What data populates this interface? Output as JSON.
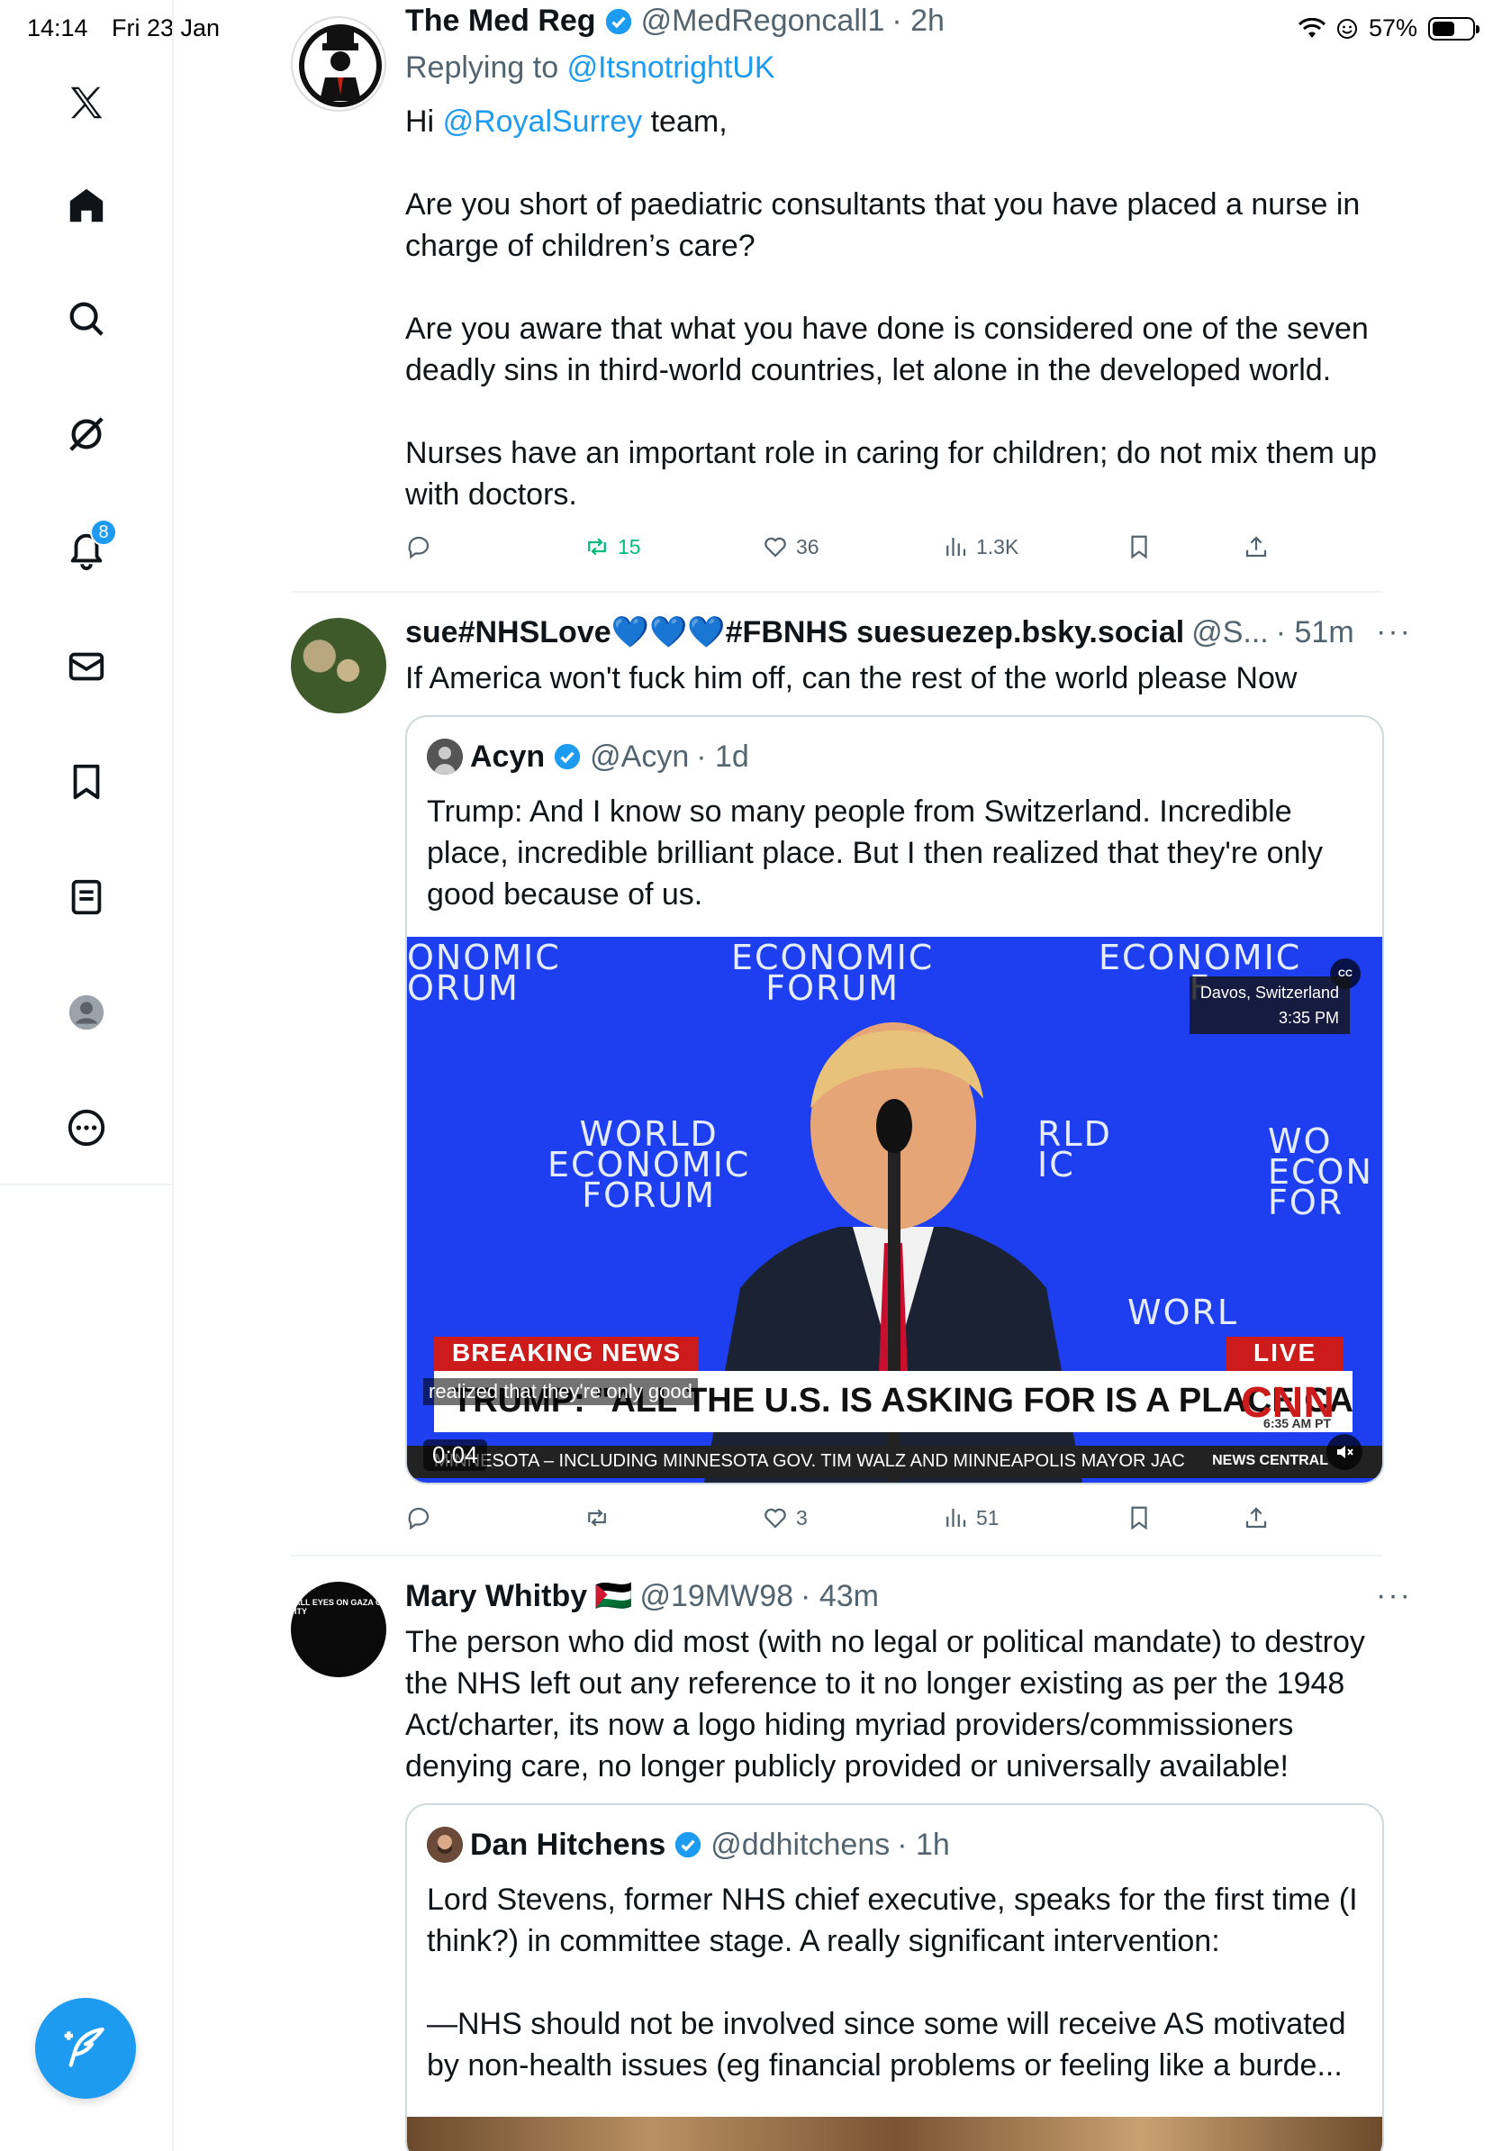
{
  "status_bar": {
    "time": "14:14",
    "date": "Fri 23 Jan",
    "battery": "57%",
    "battery_level": 0.57
  },
  "sidebar": {
    "items": [
      {
        "icon": "x-logo-icon"
      },
      {
        "icon": "home-icon"
      },
      {
        "icon": "search-icon"
      },
      {
        "icon": "grok-icon"
      },
      {
        "icon": "bell-icon",
        "badge": "8"
      },
      {
        "icon": "mail-icon"
      },
      {
        "icon": "bookmark-icon"
      },
      {
        "icon": "list-icon"
      },
      {
        "icon": "profile-icon"
      },
      {
        "icon": "more-circle-icon"
      }
    ],
    "compose_icon": "compose-feather-icon"
  },
  "tweets": [
    {
      "name": "The Med Reg",
      "handle": "@MedRegoncall1",
      "time": "· 2h",
      "reply_to_prefix": "Replying to",
      "reply_to_handle": "@ItsnotrightUK",
      "greeting_pre": "Hi",
      "greeting_link": "@RoyalSurrey",
      "greeting_post": "team,",
      "para1": "Are you short of paediatric consultants that you have placed a nurse in charge of children’s care?",
      "para2": "Are you aware that what you have done is considered one of the seven deadly sins in third-world countries, let alone in the developed world.",
      "para3": "Nurses have an important role in caring for children; do not mix them up with doctors.",
      "retweets": "15",
      "likes": "36",
      "views": "1.3K"
    },
    {
      "name": "sue#NHSLove💙💙💙#FBNHS suesuezep.bsky.social",
      "handle": "@S...",
      "time": "· 51m",
      "more": "···",
      "text": "If America won't fuck him off, can the rest of the world please Now",
      "quote": {
        "name": "Acyn",
        "handle": "@Acyn",
        "time": "· 1d",
        "text": "Trump: And I know so many people from Switzerland. Incredible place, incredible brilliant place. But I then realized that they're only good because of us.",
        "video": {
          "wef_line1": "ECONOMIC",
          "wef_line2": "FORUM",
          "wef_world": "WORLD",
          "wef_econ": "ECONOMIC",
          "wef_partial_1": "ONOMIC",
          "wef_partial_2": "ORUM",
          "wef_partial_3": "ECONOMIC",
          "wef_partial_4": "F",
          "wef_partial_5": "RLD",
          "wef_partial_6": "IC",
          "wef_partial_7": "WO",
          "wef_partial_8": "ECON",
          "wef_partial_9": "FOR",
          "wef_partial_10": "WORL",
          "location": "Davos, Switzerland",
          "clock": "3:35 PM",
          "cc": "CC",
          "breaking": "BREAKING NEWS",
          "live": "LIVE",
          "headline": "TRUMP: \"ALL THE U.S. IS ASKING FOR IS A PLACE CALLED GREENLAND\"",
          "network": "CNN",
          "network_time": "6:35 AM PT",
          "ticker": "MINNESOTA – INCLUDING MINNESOTA GOV. TIM WALZ AND MINNEAPOLIS MAYOR JAC",
          "ticker_brand": "NEWS CENTRAL",
          "subtitle": "realized that they're only good",
          "duration": "0:04"
        }
      },
      "likes": "3",
      "views": "51"
    },
    {
      "name": "Mary Whitby",
      "flag": "🇵🇸",
      "handle": "@19MW98",
      "time": "· 43m",
      "more": "···",
      "text": "The person who did most (with no legal or political mandate) to destroy the NHS left out any reference to it no longer existing as per the 1948 Act/charter, its now a logo hiding myriad providers/commissioners denying care, no longer publicly provided or universally available!",
      "avatar_text": "ALL EYES ON GAZA CITY",
      "quote": {
        "name": "Dan Hitchens",
        "handle": "@ddhitchens",
        "time": "· 1h",
        "text1": "Lord Stevens, former NHS chief executive, speaks for the first time (I think?) in committee stage. A really significant intervention:",
        "text2": "—NHS should not be involved since some will receive AS motivated by non-health issues (eg financial problems or feeling like a burde..."
      }
    }
  ],
  "colors": {
    "accent": "#1d9bf0",
    "retweet_green": "#00ba7c",
    "muted": "#536471",
    "video_blue": "#1e3ff0",
    "cnn_red": "#cc1b1b"
  }
}
